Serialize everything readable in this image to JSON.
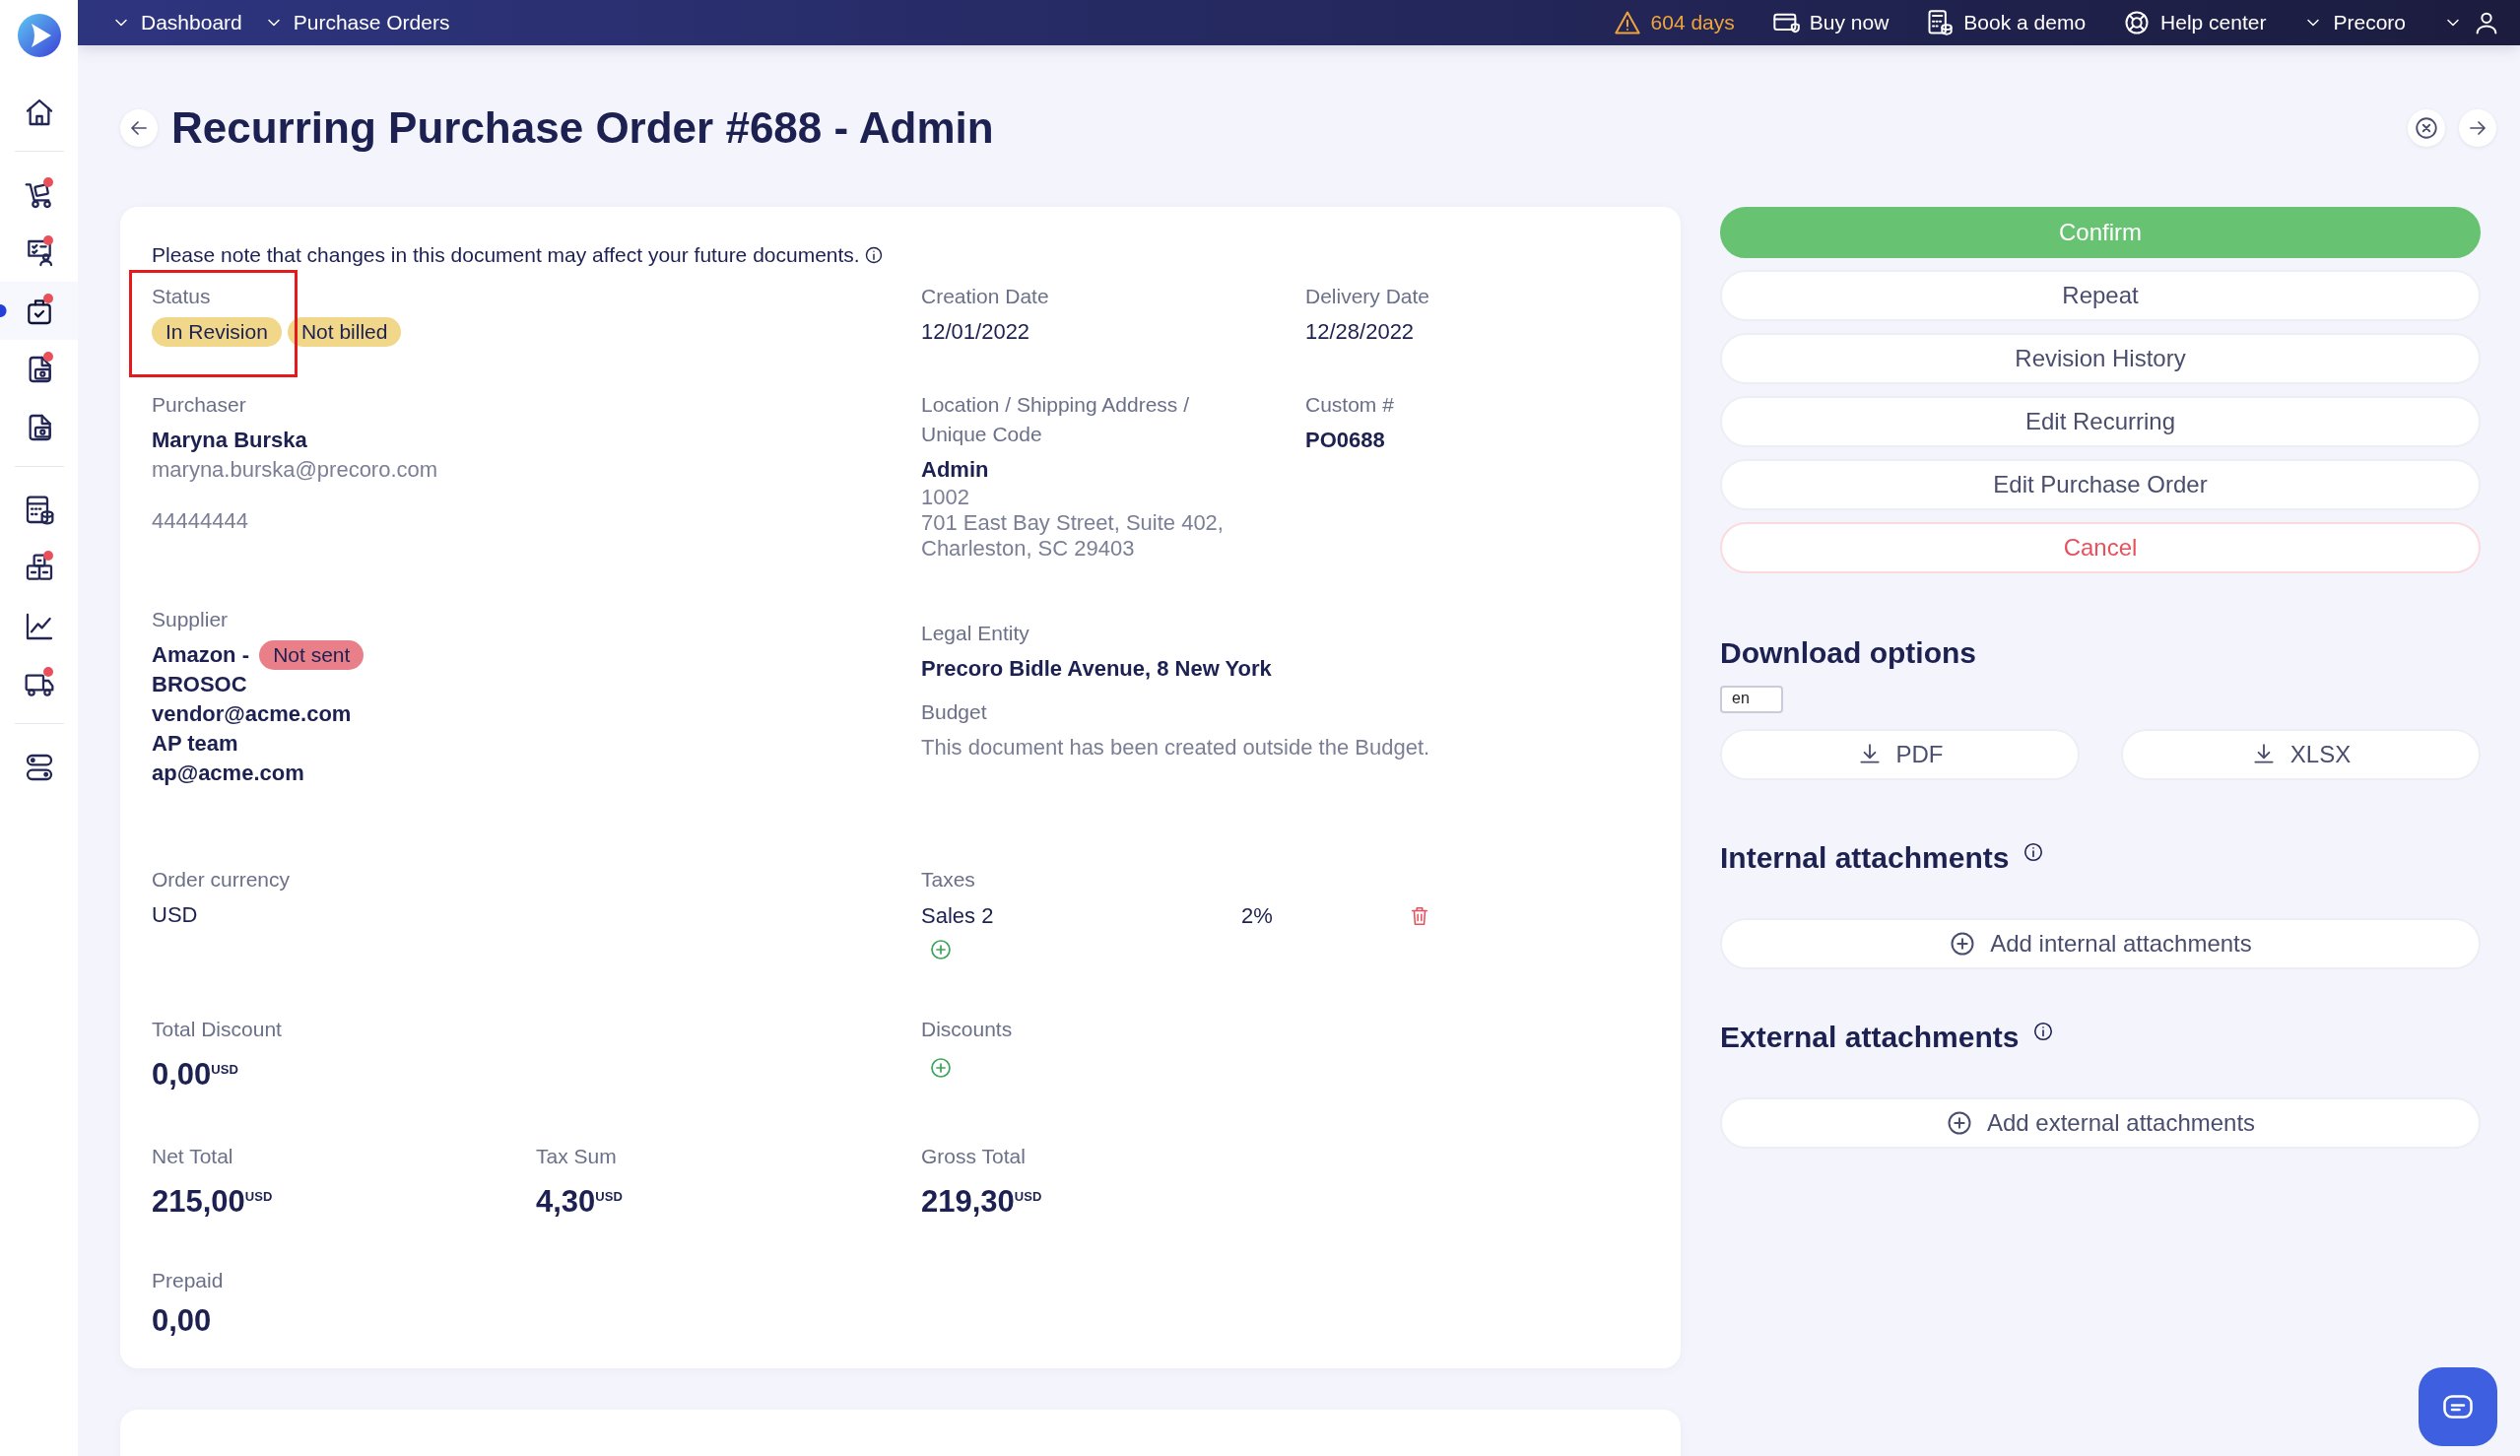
{
  "topbar": {
    "breadcrumbs": [
      "Dashboard",
      "Purchase Orders"
    ],
    "trial": "604 days",
    "links": [
      {
        "kind": "buy",
        "label": "Buy now"
      },
      {
        "kind": "demo",
        "label": "Book a demo"
      },
      {
        "kind": "help",
        "label": "Help center"
      }
    ],
    "company": "Precoro"
  },
  "sidebar": {
    "groups": [
      {
        "items": [
          {
            "kind": "home",
            "badge": false,
            "selected": false
          }
        ]
      },
      {
        "items": [
          {
            "kind": "cart",
            "badge": true,
            "selected": false
          },
          {
            "kind": "receipt",
            "badge": true,
            "selected": false
          },
          {
            "kind": "bag",
            "badge": true,
            "selected": true
          },
          {
            "kind": "doc",
            "badge": true,
            "selected": false
          },
          {
            "kind": "doc",
            "badge": false,
            "selected": false
          }
        ]
      },
      {
        "items": [
          {
            "kind": "calculator",
            "badge": false,
            "selected": false
          },
          {
            "kind": "boxes",
            "badge": true,
            "selected": false
          },
          {
            "kind": "chart",
            "badge": false,
            "selected": false
          },
          {
            "kind": "truck",
            "badge": true,
            "selected": false
          }
        ]
      },
      {
        "items": [
          {
            "kind": "toggles",
            "badge": false,
            "selected": false
          }
        ]
      }
    ]
  },
  "title": "Recurring Purchase Order #688 - Admin",
  "details": {
    "notice": "Please note that changes in this document may affect your future documents.",
    "status": {
      "label": "Status",
      "badges": [
        {
          "text": "In Revision",
          "color": "#f1d789"
        },
        {
          "text": "Not billed",
          "color": "#f1d789"
        }
      ]
    },
    "creation_date": {
      "label": "Creation Date",
      "value": "12/01/2022"
    },
    "delivery_date": {
      "label": "Delivery Date",
      "value": "12/28/2022"
    },
    "purchaser": {
      "label": "Purchaser",
      "name": "Maryna Burska",
      "email": "maryna.burska@precoro.com",
      "phone": "44444444"
    },
    "location": {
      "label": "Location / Shipping Address / Unique Code",
      "name": "Admin",
      "lines": [
        "1002",
        "701 East Bay Street, Suite 402,",
        "Charleston, SC 29403"
      ]
    },
    "custom_number": {
      "label": "Custom #",
      "value": "PO0688"
    },
    "supplier": {
      "label": "Supplier",
      "name": "Amazon -",
      "badge": {
        "text": "Not sent",
        "color": "#e97f88"
      },
      "lines": [
        "BROSOC",
        "vendor@acme.com",
        "AP team",
        "ap@acme.com"
      ]
    },
    "legal_entity": {
      "label": "Legal Entity",
      "value": "Precoro Bidle Avenue, 8 New York"
    },
    "budget": {
      "label": "Budget",
      "note": "This document has been created outside the Budget."
    },
    "order_currency": {
      "label": "Order currency",
      "value": "USD"
    },
    "taxes": {
      "label": "Taxes",
      "rows": [
        {
          "name": "Sales 2",
          "rate": "2%"
        }
      ]
    },
    "total_discount": {
      "label": "Total Discount",
      "amount": "0,00",
      "currency": "USD"
    },
    "discounts": {
      "label": "Discounts"
    },
    "net_total": {
      "label": "Net Total",
      "amount": "215,00",
      "currency": "USD"
    },
    "tax_sum": {
      "label": "Tax Sum",
      "amount": "4,30",
      "currency": "USD"
    },
    "gross_total": {
      "label": "Gross Total",
      "amount": "219,30",
      "currency": "USD"
    },
    "prepaid": {
      "label": "Prepaid",
      "amount": "0,00"
    }
  },
  "actions": [
    {
      "kind": "primary",
      "label": "Confirm"
    },
    {
      "kind": "default",
      "label": "Repeat"
    },
    {
      "kind": "default",
      "label": "Revision History"
    },
    {
      "kind": "default",
      "label": "Edit Recurring"
    },
    {
      "kind": "default",
      "label": "Edit Purchase Order"
    },
    {
      "kind": "danger",
      "label": "Cancel"
    }
  ],
  "download": {
    "title": "Download options",
    "language": "en",
    "buttons": [
      "PDF",
      "XLSX"
    ]
  },
  "attachments": [
    {
      "title": "Internal attachments",
      "button": "Add internal attachments"
    },
    {
      "title": "External attachments",
      "button": "Add external attachments"
    }
  ]
}
